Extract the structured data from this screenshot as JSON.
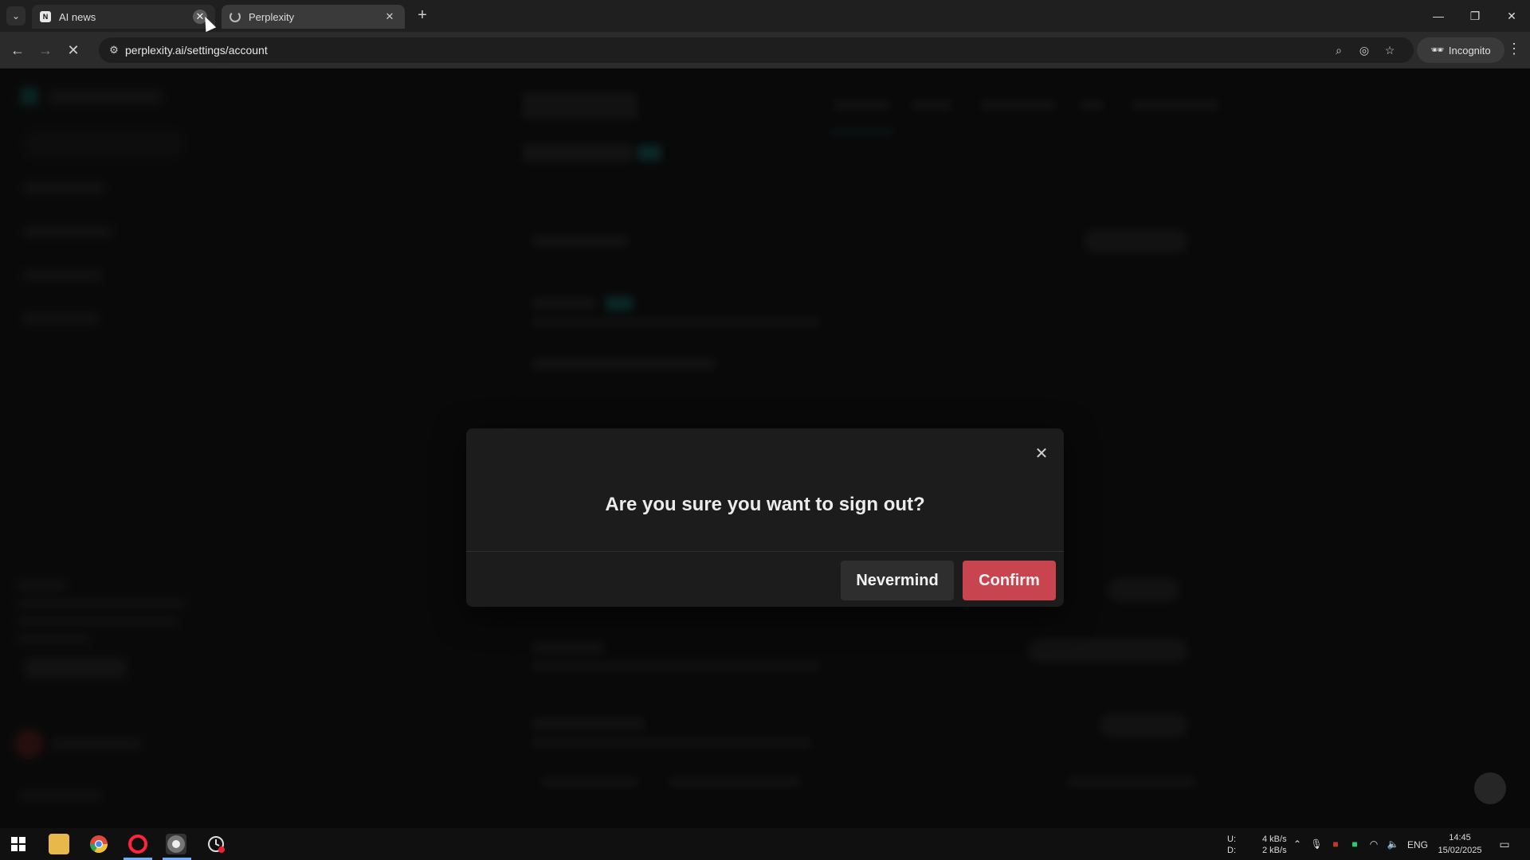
{
  "browser": {
    "tabs": [
      {
        "title": "AI news",
        "active": false
      },
      {
        "title": "Perplexity",
        "active": true
      }
    ],
    "url": "perplexity.ai/settings/account",
    "incognito_label": "Incognito",
    "icons": {
      "tab_search": "chevron-down-icon",
      "back": "arrow-left-icon",
      "forward": "arrow-right-icon",
      "stop": "close-icon",
      "site_info": "tune-icon",
      "zoom": "zoom-icon",
      "eye_off": "eye-off-icon",
      "bookmark": "star-icon",
      "menu": "kebab-icon"
    }
  },
  "dialog": {
    "title": "Are you sure you want to sign out?",
    "cancel_label": "Nevermind",
    "confirm_label": "Confirm",
    "confirm_color": "#c8454f"
  },
  "taskbar": {
    "net_up_label": "U:",
    "net_down_label": "D:",
    "net_up": "4 kB/s",
    "net_down": "2 kB/s",
    "language": "ENG",
    "time": "14:45",
    "date": "15/02/2025"
  }
}
